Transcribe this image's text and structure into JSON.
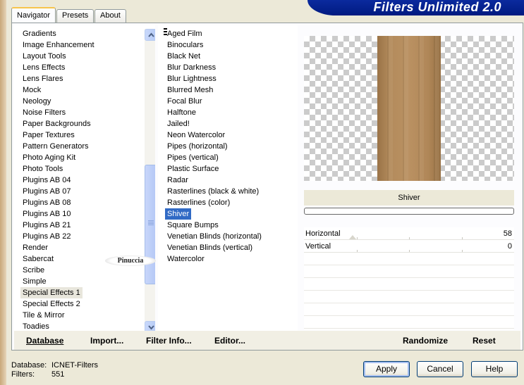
{
  "tabs": [
    "Navigator",
    "Presets",
    "About"
  ],
  "banner_title": "Filters Unlimited 2.0",
  "categories": [
    "Gradients",
    "Image Enhancement",
    "Layout Tools",
    "Lens Effects",
    "Lens Flares",
    "Mock",
    "Neology",
    "Noise Filters",
    "Paper Backgrounds",
    "Paper Textures",
    "Pattern Generators",
    "Photo Aging Kit",
    "Photo Tools",
    "Plugins AB 04",
    "Plugins AB 07",
    "Plugins AB 08",
    "Plugins AB 10",
    "Plugins AB 21",
    "Plugins AB 22",
    "Render",
    "Sabercat",
    "Scribe",
    "Simple",
    "Special Effects 1",
    "Special Effects 2",
    "Tile & Mirror",
    "Toadies"
  ],
  "selected_category": "Special Effects 1",
  "filters": [
    "Aged Film",
    "Binoculars",
    "Black Net",
    "Blur Darkness",
    "Blur Lightness",
    "Blurred Mesh",
    "Focal Blur",
    "Halftone",
    "Jailed!",
    "Neon Watercolor",
    "Pipes (horizontal)",
    "Pipes (vertical)",
    "Plastic Surface",
    "Radar",
    "Rasterlines (black & white)",
    "Rasterlines (color)",
    "Shiver",
    "Square Bumps",
    "Venetian Blinds (horizontal)",
    "Venetian Blinds (vertical)",
    "Watercolor"
  ],
  "selected_filter": "Shiver",
  "current_filter_name": "Shiver",
  "parameters": [
    {
      "label": "Horizontal",
      "value": "58",
      "level": 0.23
    },
    {
      "label": "Vertical",
      "value": "0",
      "level": 0
    }
  ],
  "watermark": "Pinuccia",
  "bottom_buttons": {
    "database": "Database",
    "import": "Import...",
    "filter_info": "Filter Info...",
    "editor": "Editor...",
    "randomize": "Randomize",
    "reset": "Reset"
  },
  "footer": {
    "database_label": "Database:",
    "database_value": "ICNET-Filters",
    "filters_label": "Filters:",
    "filters_value": "551"
  },
  "dialog_buttons": {
    "apply": "Apply",
    "cancel": "Cancel",
    "help": "Help"
  },
  "colors": {
    "selection": "#316ac5",
    "banner": "#0b2a9e",
    "wood": "#b38b5c"
  }
}
